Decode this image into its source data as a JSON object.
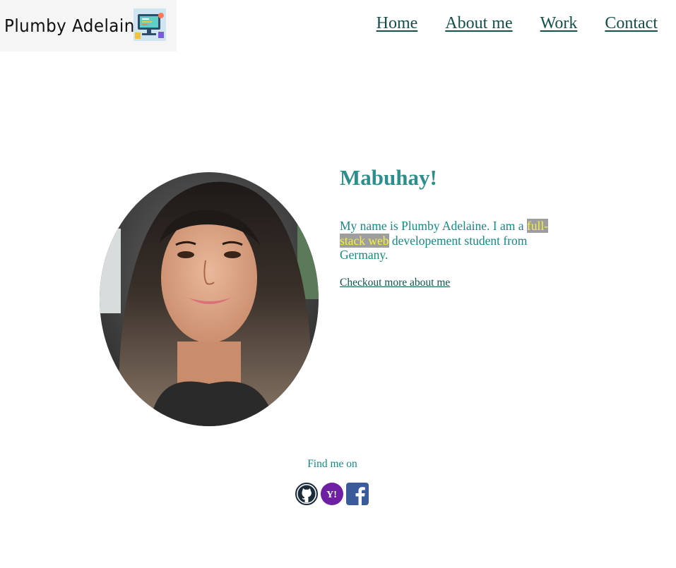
{
  "header": {
    "logo_text": "Plumby Adelaine",
    "nav": [
      {
        "label": "Home"
      },
      {
        "label": "About me"
      },
      {
        "label": "Work"
      },
      {
        "label": "Contact"
      }
    ]
  },
  "intro": {
    "greeting": "Mabuhay!",
    "bio_prefix": "My name is Plumby Adelaine. I am a ",
    "bio_highlight": "full-stack web",
    "bio_suffix": " developement student from Germany.",
    "more_link": "Checkout more about me"
  },
  "footer": {
    "find_me": "Find me on",
    "socials": [
      {
        "icon": "github-icon"
      },
      {
        "icon": "yahoo-icon"
      },
      {
        "icon": "facebook-icon"
      }
    ]
  },
  "colors": {
    "nav_link": "#14504a",
    "heading": "#2d8f8c",
    "body_text": "#138a84",
    "highlight_bg": "#9e9e9e",
    "highlight_text": "#f6f33a",
    "yahoo": "#6e1fa3",
    "facebook": "#3b5a99",
    "github": "#1b2b3a"
  }
}
